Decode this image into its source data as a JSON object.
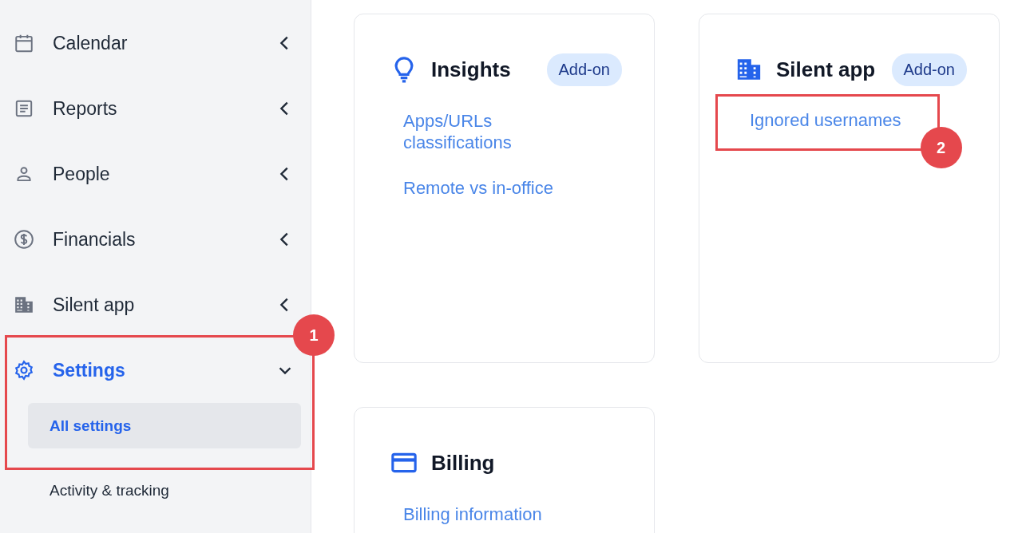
{
  "sidebar": {
    "items": [
      {
        "label": "Calendar",
        "expanded": false,
        "selected": false
      },
      {
        "label": "Reports",
        "expanded": false,
        "selected": false
      },
      {
        "label": "People",
        "expanded": false,
        "selected": false
      },
      {
        "label": "Financials",
        "expanded": false,
        "selected": false
      },
      {
        "label": "Silent app",
        "expanded": false,
        "selected": false
      },
      {
        "label": "Settings",
        "expanded": true,
        "selected": true,
        "callout": "1",
        "children": [
          {
            "label": "All settings",
            "selected": true
          },
          {
            "label": "Activity & tracking",
            "selected": false
          }
        ]
      }
    ]
  },
  "cards": [
    {
      "title": "Insights",
      "badge": "Add-on",
      "links": [
        {
          "label": "Apps/URLs classifications"
        },
        {
          "label": "Remote vs in-office"
        }
      ]
    },
    {
      "title": "Silent app",
      "badge": "Add-on",
      "links": [
        {
          "label": "Ignored usernames",
          "callout": "2"
        }
      ]
    },
    {
      "title": "Billing",
      "links": [
        {
          "label": "Billing information"
        }
      ]
    }
  ]
}
